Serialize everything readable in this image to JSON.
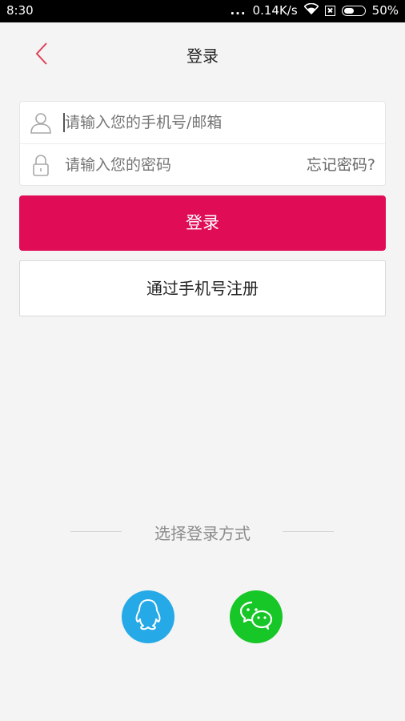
{
  "status_bar": {
    "time": "8:30",
    "dots": "...",
    "network_speed": "0.14K/s",
    "battery": "50%",
    "battery_level": 0.5,
    "icons": [
      "wifi-icon",
      "sim-icon",
      "battery-icon"
    ]
  },
  "header": {
    "title": "登录",
    "back_icon": "chevron-left-icon"
  },
  "form": {
    "account_placeholder": "请输入您的手机号/邮箱",
    "account_icon": "user-icon",
    "password_placeholder": "请输入您的密码",
    "password_icon": "lock-icon",
    "forgot_label": "忘记密码?"
  },
  "buttons": {
    "login_label": "登录",
    "register_label": "通过手机号注册"
  },
  "other_login": {
    "label": "选择登录方式",
    "options": [
      {
        "name": "qq",
        "icon": "qq-icon"
      },
      {
        "name": "wechat",
        "icon": "wechat-icon"
      }
    ]
  },
  "colors": {
    "accent": "#e00c56",
    "back_arrow": "#e0405a",
    "background": "#f4f4f4",
    "qq": "#25a9e7",
    "wechat": "#17c627"
  }
}
